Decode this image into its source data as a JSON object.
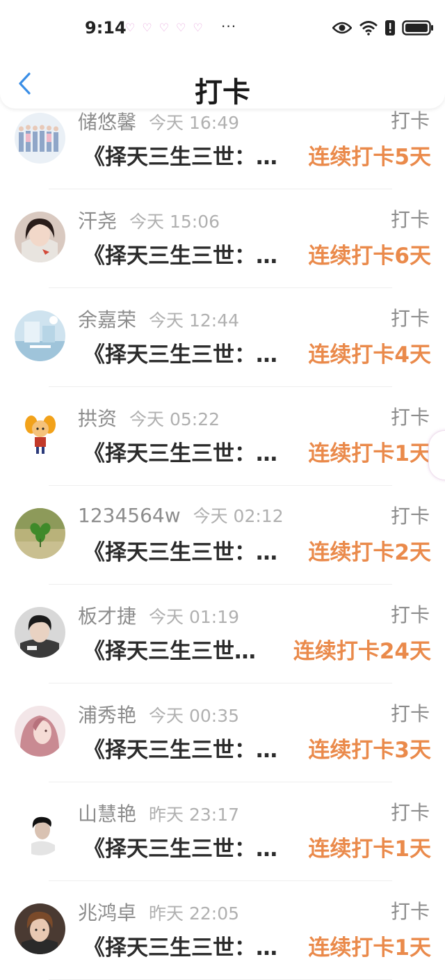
{
  "status_bar": {
    "time": "9:14",
    "hearts": [
      "♡",
      "♡",
      "♡",
      "♡",
      "♡"
    ],
    "more": "···",
    "icons": [
      "eye-icon",
      "wifi-icon",
      "alert-icon",
      "battery-icon"
    ]
  },
  "nav": {
    "title": "打卡",
    "back_icon": "chevron-left-icon"
  },
  "colors": {
    "accent_orange": "#ea8a4b",
    "back_blue": "#3a8ee6",
    "name_gray": "#8c8c8c",
    "time_gray": "#b0b0b0"
  },
  "entries": [
    {
      "name": "储悠馨",
      "time": "今天 16:49",
      "action": "打卡",
      "book": "《择天三生三世：…",
      "streak": "连续打卡5天"
    },
    {
      "name": "汗尧",
      "time": "今天 15:06",
      "action": "打卡",
      "book": "《择天三生三世：…",
      "streak": "连续打卡6天"
    },
    {
      "name": "余嘉荣",
      "time": "今天 12:44",
      "action": "打卡",
      "book": "《择天三生三世：…",
      "streak": "连续打卡4天"
    },
    {
      "name": "拱资",
      "time": "今天 05:22",
      "action": "打卡",
      "book": "《择天三生三世：…",
      "streak": "连续打卡1天"
    },
    {
      "name": "1234564w",
      "time": "今天 02:12",
      "action": "打卡",
      "book": "《择天三生三世：…",
      "streak": "连续打卡2天"
    },
    {
      "name": "板才捷",
      "time": "今天 01:19",
      "action": "打卡",
      "book": "《择天三生三世…",
      "streak": "连续打卡24天"
    },
    {
      "name": "浦秀艳",
      "time": "今天 00:35",
      "action": "打卡",
      "book": "《择天三生三世：…",
      "streak": "连续打卡3天"
    },
    {
      "name": "山慧艳",
      "time": "昨天 23:17",
      "action": "打卡",
      "book": "《择天三生三世：…",
      "streak": "连续打卡1天"
    },
    {
      "name": "兆鸿卓",
      "time": "昨天 22:05",
      "action": "打卡",
      "book": "《择天三生三世：…",
      "streak": "连续打卡1天"
    }
  ]
}
